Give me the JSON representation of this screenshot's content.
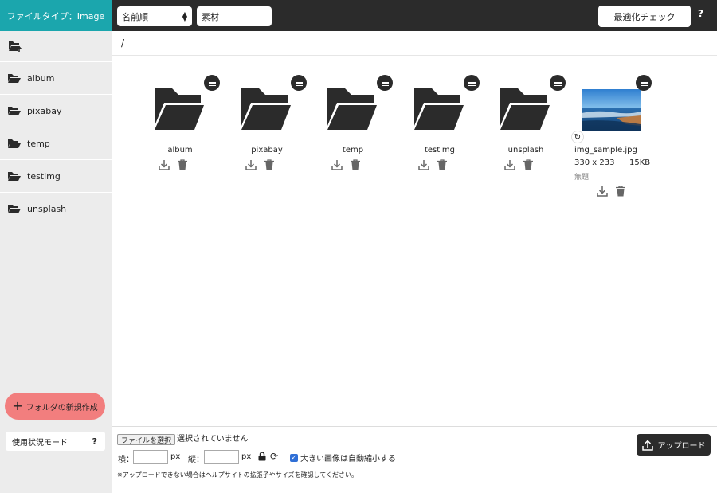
{
  "header": {
    "file_type_tab": "ファイルタイプ：Image",
    "sort": {
      "selected": "名前順"
    },
    "search": {
      "value": "素材",
      "placeholder": ""
    },
    "optimize_button": "最適化チェック",
    "help_label": "?"
  },
  "sidebar": {
    "items": [
      {
        "label": "album"
      },
      {
        "label": "pixabay"
      },
      {
        "label": "temp"
      },
      {
        "label": "testimg"
      },
      {
        "label": "unsplash"
      }
    ],
    "new_folder_label": "フォルダの新規作成",
    "usage_mode_label": "使用状況モード",
    "usage_help": "?"
  },
  "breadcrumb": {
    "path": "/"
  },
  "folders": [
    {
      "name": "album"
    },
    {
      "name": "pixabay"
    },
    {
      "name": "temp"
    },
    {
      "name": "testimg"
    },
    {
      "name": "unsplash"
    }
  ],
  "image_file": {
    "name": "img_sample.jpg",
    "dimensions": "330 x 233",
    "size": "15KB",
    "caption": "無題"
  },
  "upload_panel": {
    "choose_file_label": "ファイルを選択",
    "no_file_text": "選択されていません",
    "width_label": "横：",
    "height_label": "縦：",
    "unit": "px",
    "auto_resize_label": "大きい画像は自動縮小する",
    "auto_resize_checked": true,
    "notice": "※アップロードできない場合はヘルプサイトの拡張子やサイズを確認してください。",
    "upload_button": "アップロード"
  },
  "colors": {
    "accent_teal": "#1ba6ad",
    "dark_bar": "#2b2b2b",
    "highlight": "#f27e7e"
  }
}
